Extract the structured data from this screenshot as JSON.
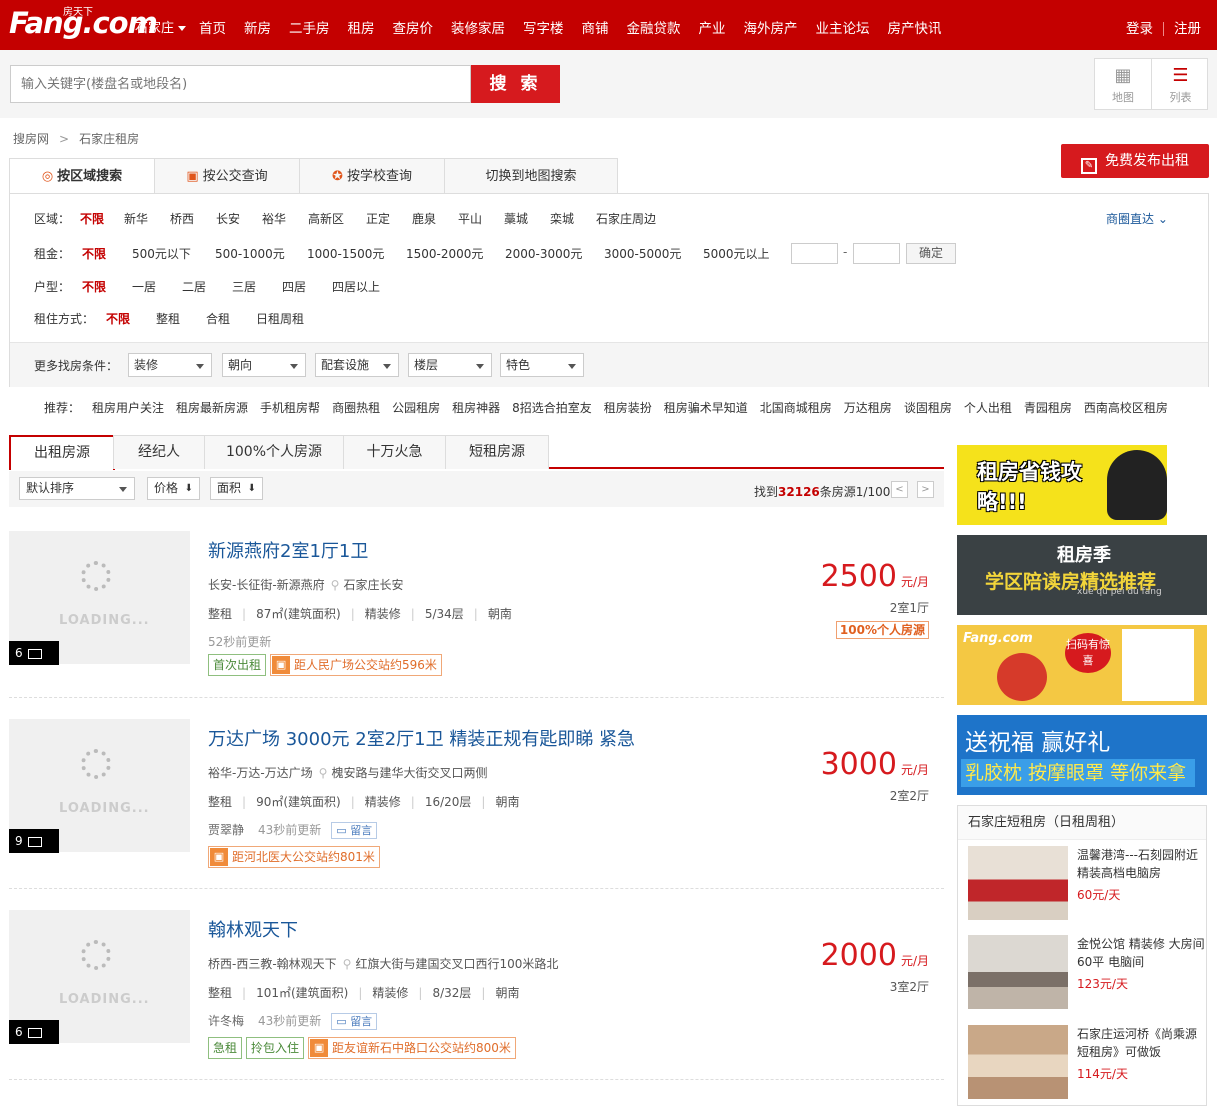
{
  "header": {
    "logo": "Fang.com",
    "logo_cn": "房天下",
    "city": "石家庄",
    "nav": [
      "首页",
      "新房",
      "二手房",
      "租房",
      "查房价",
      "装修家居",
      "写字楼",
      "商铺",
      "金融贷款",
      "产业",
      "海外房产",
      "业主论坛",
      "房产快讯"
    ],
    "login": "登录",
    "register": "注册"
  },
  "search": {
    "placeholder": "输入关键字(楼盘名或地段名)",
    "button": "搜 索",
    "map_label": "地图",
    "list_label": "列表"
  },
  "breadcrumb": [
    "搜房网",
    "石家庄租房"
  ],
  "breadcrumb_sep": ">",
  "publish_button": "免费发布出租",
  "search_tabs": [
    "按区域搜索",
    "按公交查询",
    "按学校查询",
    "切换到地图搜索"
  ],
  "filters": {
    "area_label": "区域：",
    "area": [
      "不限",
      "新华",
      "桥西",
      "长安",
      "裕华",
      "高新区",
      "正定",
      "鹿泉",
      "平山",
      "藁城",
      "栾城",
      "石家庄周边"
    ],
    "area_more": "商圈直达",
    "rent_label": "租金：",
    "rent": [
      "不限",
      "500元以下",
      "500-1000元",
      "1000-1500元",
      "1500-2000元",
      "2000-3000元",
      "3000-5000元",
      "5000元以上"
    ],
    "rent_dash": "-",
    "rent_confirm": "确定",
    "type_label": "户型：",
    "type": [
      "不限",
      "一居",
      "二居",
      "三居",
      "四居",
      "四居以上"
    ],
    "mode_label": "租住方式：",
    "mode": [
      "不限",
      "整租",
      "合租",
      "日租周租"
    ],
    "more_label": "更多找房条件：",
    "more": [
      "装修",
      "朝向",
      "配套设施",
      "楼层",
      "特色"
    ]
  },
  "recommend": {
    "label": "推荐：",
    "items": [
      "租房用户关注",
      "租房最新房源",
      "手机租房帮",
      "商圈热租",
      "公园租房",
      "租房神器",
      "8招选合拍室友",
      "租房装扮",
      "租房骗术早知道",
      "北国商城租房",
      "万达租房",
      "谈固租房",
      "个人出租",
      "青园租房",
      "西南高校区租房"
    ]
  },
  "list_tabs": [
    "出租房源",
    "经纪人",
    "100%个人房源",
    "十万火急",
    "短租房源"
  ],
  "sort": {
    "default": "默认排序",
    "price": "价格",
    "area": "面积",
    "found_prefix": "找到",
    "found_count": "32126",
    "found_suffix": "条房源1/100",
    "prev": "<",
    "next": ">"
  },
  "listings": [
    {
      "title": "新源燕府2室1厅1卫",
      "district": "长安-长征街-新源燕府",
      "location": "石家庄长安",
      "attrs": [
        "整租",
        "87㎡(建筑面积)",
        "精装修",
        "5/34层",
        "朝南"
      ],
      "agent": "",
      "updated": "52秒前更新",
      "has_message": false,
      "tags": [
        {
          "text": "首次出租",
          "style": "green"
        }
      ],
      "bus": "距人民广场公交站约596米",
      "price": "2500",
      "unit": "元/月",
      "rooms": "2室1厅",
      "personal": "100%个人房源",
      "photos": "6"
    },
    {
      "title": "万达广场 3000元 2室2厅1卫 精装正规有匙即睇 紧急",
      "district": "裕华-万达-万达广场",
      "location": "槐安路与建华大街交叉口两侧",
      "attrs": [
        "整租",
        "90㎡(建筑面积)",
        "精装修",
        "16/20层",
        "朝南"
      ],
      "agent": "贾翠静",
      "updated": "43秒前更新",
      "has_message": true,
      "tags": [],
      "bus": "距河北医大公交站约801米",
      "price": "3000",
      "unit": "元/月",
      "rooms": "2室2厅",
      "personal": "",
      "photos": "9"
    },
    {
      "title": "翰林观天下",
      "district": "桥西-西三教-翰林观天下",
      "location": "红旗大街与建国交叉口西行100米路北",
      "attrs": [
        "整租",
        "101㎡(建筑面积)",
        "精装修",
        "8/32层",
        "朝南"
      ],
      "agent": "许冬梅",
      "updated": "43秒前更新",
      "has_message": true,
      "tags": [
        {
          "text": "急租",
          "style": "green"
        },
        {
          "text": "拎包入住",
          "style": "green"
        }
      ],
      "bus": "距友谊新石中路口公交站约800米",
      "price": "2000",
      "unit": "元/月",
      "rooms": "3室2厅",
      "personal": "",
      "photos": "6"
    }
  ],
  "message_label": "留言",
  "loading_text": "LOADING...",
  "ads": {
    "ad1": "租房省钱攻略!!!",
    "ad2_title": "租房季",
    "ad2_sub": "学区陪读房精选推荐",
    "ad2_pinyin": "xue qu pei du fang",
    "ad3_logo": "Fang.com",
    "ad3_scan": "扫码有惊喜",
    "ad4_title": "送祝福 赢好礼",
    "ad4_sub": "乳胶枕 按摩眼罩 等你来拿"
  },
  "short_rent": {
    "title": "石家庄短租房（日租周租）",
    "items": [
      {
        "name": "温馨港湾---石刻园附近精装高档电脑房",
        "price": "60元/天"
      },
      {
        "name": "金悦公馆 精装修 大房间60平 电脑间",
        "price": "123元/天"
      },
      {
        "name": "石家庄运河桥《尚乘源短租房》可做饭",
        "price": "114元/天"
      }
    ]
  },
  "colors": {
    "brand_red": "#c40000",
    "price_red": "#d61a1e",
    "link_blue": "#1a5799"
  }
}
